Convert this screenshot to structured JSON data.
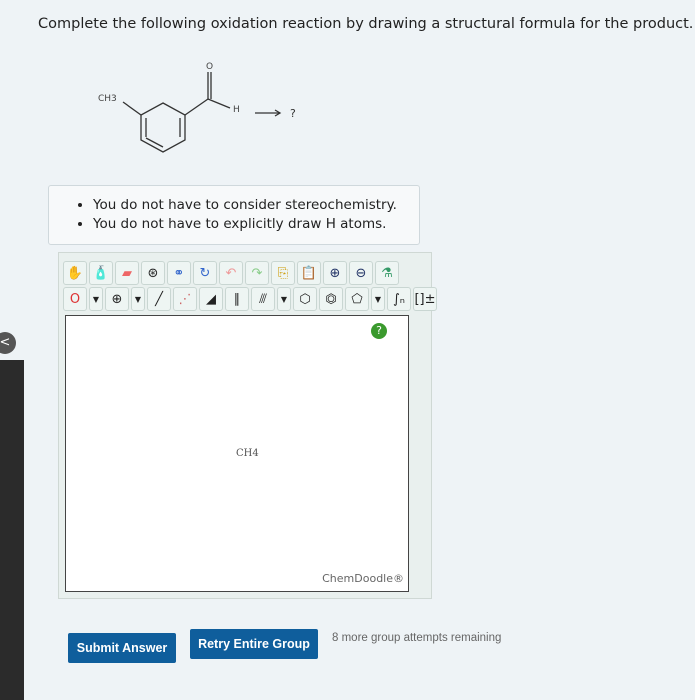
{
  "question": "Complete the following oxidation reaction by drawing a structural formula for the product.",
  "reaction": {
    "substituent": "CH3",
    "oxygen": "O",
    "hydrogen": "H",
    "product": "?"
  },
  "notes": [
    "You do not have to consider stereochemistry.",
    "You do not have to explicitly draw H atoms."
  ],
  "editor": {
    "element_label": "O",
    "canvas_label": "CH4",
    "brand": "ChemDoodle®",
    "help": "?",
    "tools_row1": [
      "hand-icon",
      "erase-bottle-icon",
      "eraser-icon",
      "center-icon",
      "flip-icon",
      "rotate-icon",
      "undo-icon",
      "redo-icon",
      "copy-icon",
      "paste-icon",
      "zoom-in-icon",
      "zoom-out-icon",
      "clean-icon"
    ],
    "tools_row2": [
      "single-bond-icon",
      "dashed-bond-icon",
      "wedge-bond-icon",
      "double-bond-icon",
      "triple-bond-icon",
      "cyclohexane-icon",
      "benzene-icon",
      "cyclopentane-icon",
      "repeat-unit-icon",
      "bracket-charge-icon"
    ]
  },
  "buttons": {
    "submit": "Submit Answer",
    "retry": "Retry Entire Group"
  },
  "attempts": "8 more group attempts remaining"
}
